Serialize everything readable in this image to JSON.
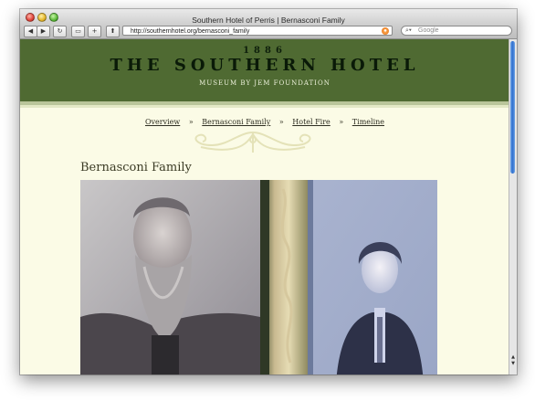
{
  "window": {
    "title": "Southern Hotel of Perris | Bernasconi Family"
  },
  "toolbar": {
    "back_icon": "back-arrow-icon",
    "forward_icon": "forward-arrow-icon",
    "reload_icon": "reload-icon",
    "url": "http://southernhotel.org/bernasconi_family",
    "search_placeholder": "Google"
  },
  "banner": {
    "year": "1886",
    "title": "THE SOUTHERN HOTEL",
    "subtitle": "MUSEUM BY JEM FOUNDATION",
    "background_color": "#4f6a32"
  },
  "nav": {
    "items": [
      {
        "label": "Overview"
      },
      {
        "label": "Bernasconi Family"
      },
      {
        "label": "Hotel Fire"
      },
      {
        "label": "Timeline"
      }
    ],
    "separator": "»"
  },
  "page": {
    "heading": "Bernasconi Family",
    "background_color": "#fbfbe6"
  }
}
